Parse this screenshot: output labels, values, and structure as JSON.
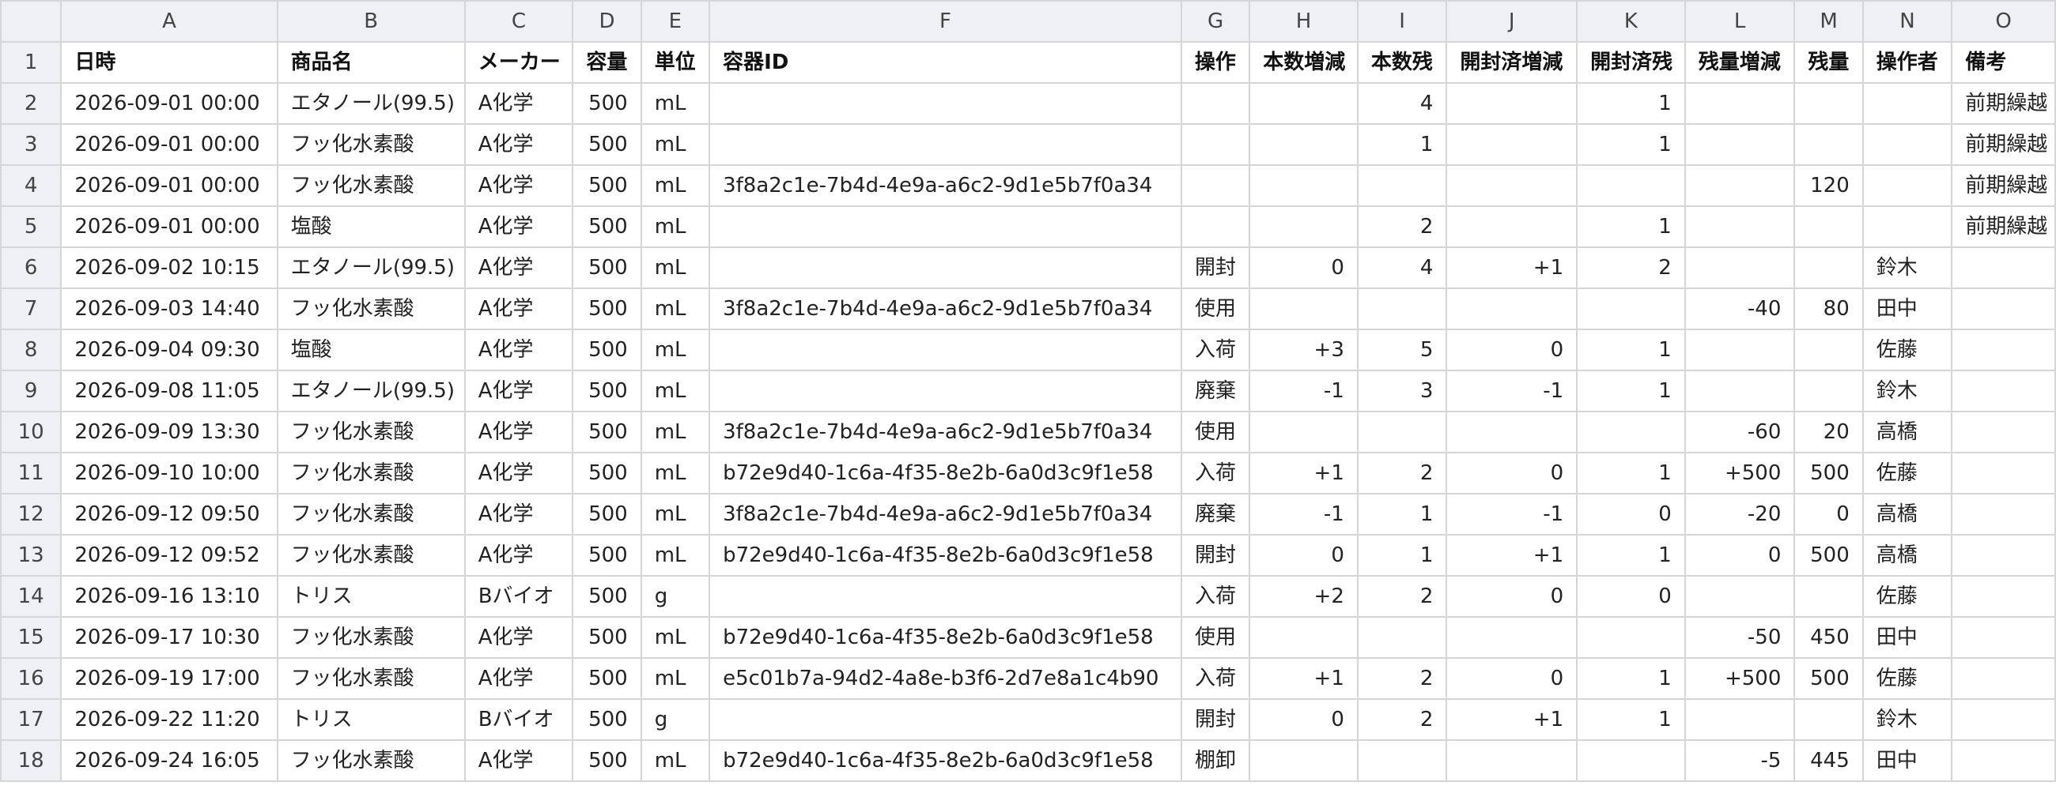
{
  "columns": [
    "A",
    "B",
    "C",
    "D",
    "E",
    "F",
    "G",
    "H",
    "I",
    "J",
    "K",
    "L",
    "M",
    "N",
    "O"
  ],
  "header_row_number": "1",
  "header": [
    "日時",
    "商品名",
    "メーカー",
    "容量",
    "単位",
    "容器ID",
    "操作",
    "本数増減",
    "本数残",
    "開封済増減",
    "開封済残",
    "残量増減",
    "残量",
    "操作者",
    "備考"
  ],
  "rows": [
    {
      "num": "2",
      "cells": [
        "2026-09-01 00:00",
        "エタノール(99.5)",
        "A化学",
        "500",
        "mL",
        "",
        "",
        "",
        "4",
        "",
        "1",
        "",
        "",
        "",
        "前期繰越"
      ]
    },
    {
      "num": "3",
      "cells": [
        "2026-09-01 00:00",
        "フッ化水素酸",
        "A化学",
        "500",
        "mL",
        "",
        "",
        "",
        "1",
        "",
        "1",
        "",
        "",
        "",
        "前期繰越"
      ]
    },
    {
      "num": "4",
      "cells": [
        "2026-09-01 00:00",
        "フッ化水素酸",
        "A化学",
        "500",
        "mL",
        "3f8a2c1e-7b4d-4e9a-a6c2-9d1e5b7f0a34",
        "",
        "",
        "",
        "",
        "",
        "",
        "120",
        "",
        "前期繰越"
      ]
    },
    {
      "num": "5",
      "cells": [
        "2026-09-01 00:00",
        "塩酸",
        "A化学",
        "500",
        "mL",
        "",
        "",
        "",
        "2",
        "",
        "1",
        "",
        "",
        "",
        "前期繰越"
      ]
    },
    {
      "num": "6",
      "cells": [
        "2026-09-02 10:15",
        "エタノール(99.5)",
        "A化学",
        "500",
        "mL",
        "",
        "開封",
        "0",
        "4",
        "+1",
        "2",
        "",
        "",
        "鈴木",
        ""
      ]
    },
    {
      "num": "7",
      "cells": [
        "2026-09-03 14:40",
        "フッ化水素酸",
        "A化学",
        "500",
        "mL",
        "3f8a2c1e-7b4d-4e9a-a6c2-9d1e5b7f0a34",
        "使用",
        "",
        "",
        "",
        "",
        "-40",
        "80",
        "田中",
        ""
      ]
    },
    {
      "num": "8",
      "cells": [
        "2026-09-04 09:30",
        "塩酸",
        "A化学",
        "500",
        "mL",
        "",
        "入荷",
        "+3",
        "5",
        "0",
        "1",
        "",
        "",
        "佐藤",
        ""
      ]
    },
    {
      "num": "9",
      "cells": [
        "2026-09-08 11:05",
        "エタノール(99.5)",
        "A化学",
        "500",
        "mL",
        "",
        "廃棄",
        "-1",
        "3",
        "-1",
        "1",
        "",
        "",
        "鈴木",
        ""
      ]
    },
    {
      "num": "10",
      "cells": [
        "2026-09-09 13:30",
        "フッ化水素酸",
        "A化学",
        "500",
        "mL",
        "3f8a2c1e-7b4d-4e9a-a6c2-9d1e5b7f0a34",
        "使用",
        "",
        "",
        "",
        "",
        "-60",
        "20",
        "高橋",
        ""
      ]
    },
    {
      "num": "11",
      "cells": [
        "2026-09-10 10:00",
        "フッ化水素酸",
        "A化学",
        "500",
        "mL",
        "b72e9d40-1c6a-4f35-8e2b-6a0d3c9f1e58",
        "入荷",
        "+1",
        "2",
        "0",
        "1",
        "+500",
        "500",
        "佐藤",
        ""
      ]
    },
    {
      "num": "12",
      "cells": [
        "2026-09-12 09:50",
        "フッ化水素酸",
        "A化学",
        "500",
        "mL",
        "3f8a2c1e-7b4d-4e9a-a6c2-9d1e5b7f0a34",
        "廃棄",
        "-1",
        "1",
        "-1",
        "0",
        "-20",
        "0",
        "高橋",
        ""
      ]
    },
    {
      "num": "13",
      "cells": [
        "2026-09-12 09:52",
        "フッ化水素酸",
        "A化学",
        "500",
        "mL",
        "b72e9d40-1c6a-4f35-8e2b-6a0d3c9f1e58",
        "開封",
        "0",
        "1",
        "+1",
        "1",
        "0",
        "500",
        "高橋",
        ""
      ]
    },
    {
      "num": "14",
      "cells": [
        "2026-09-16 13:10",
        "トリス",
        "Bバイオ",
        "500",
        "g",
        "",
        "入荷",
        "+2",
        "2",
        "0",
        "0",
        "",
        "",
        "佐藤",
        ""
      ]
    },
    {
      "num": "15",
      "cells": [
        "2026-09-17 10:30",
        "フッ化水素酸",
        "A化学",
        "500",
        "mL",
        "b72e9d40-1c6a-4f35-8e2b-6a0d3c9f1e58",
        "使用",
        "",
        "",
        "",
        "",
        "-50",
        "450",
        "田中",
        ""
      ]
    },
    {
      "num": "16",
      "cells": [
        "2026-09-19 17:00",
        "フッ化水素酸",
        "A化学",
        "500",
        "mL",
        "e5c01b7a-94d2-4a8e-b3f6-2d7e8a1c4b90",
        "入荷",
        "+1",
        "2",
        "0",
        "1",
        "+500",
        "500",
        "佐藤",
        ""
      ]
    },
    {
      "num": "17",
      "cells": [
        "2026-09-22 11:20",
        "トリス",
        "Bバイオ",
        "500",
        "g",
        "",
        "開封",
        "0",
        "2",
        "+1",
        "1",
        "",
        "",
        "鈴木",
        ""
      ]
    },
    {
      "num": "18",
      "cells": [
        "2026-09-24 16:05",
        "フッ化水素酸",
        "A化学",
        "500",
        "mL",
        "b72e9d40-1c6a-4f35-8e2b-6a0d3c9f1e58",
        "棚卸",
        "",
        "",
        "",
        "",
        "-5",
        "445",
        "田中",
        ""
      ]
    }
  ]
}
